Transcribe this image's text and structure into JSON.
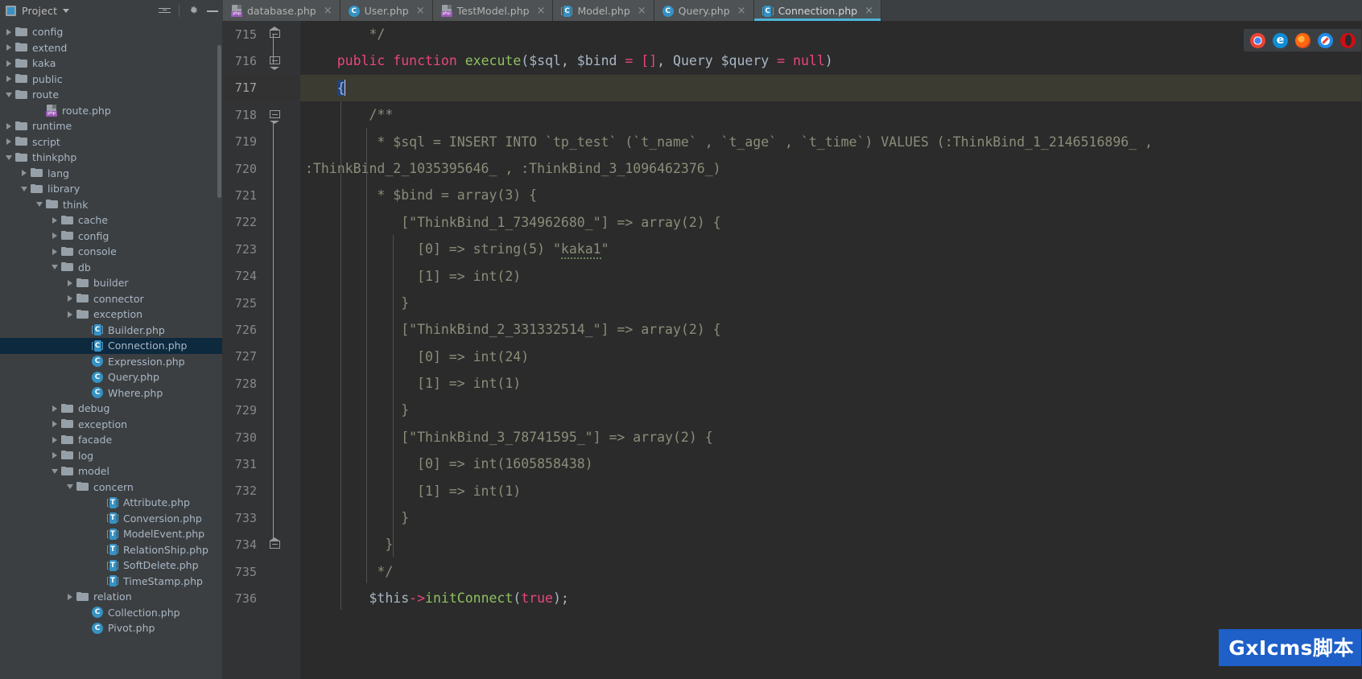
{
  "project_panel": {
    "title": "Project",
    "icons": [
      "collapse-all-icon",
      "settings-gear-icon",
      "hide-panel-icon"
    ],
    "tree": [
      {
        "label": "config",
        "type": "folder",
        "depth": 1,
        "state": "collapsed"
      },
      {
        "label": "extend",
        "type": "folder",
        "depth": 1,
        "state": "collapsed"
      },
      {
        "label": "kaka",
        "type": "folder",
        "depth": 1,
        "state": "collapsed"
      },
      {
        "label": "public",
        "type": "folder",
        "depth": 1,
        "state": "collapsed"
      },
      {
        "label": "route",
        "type": "folder",
        "depth": 1,
        "state": "expanded"
      },
      {
        "label": "route.php",
        "type": "php",
        "depth": 3,
        "state": "leaf"
      },
      {
        "label": "runtime",
        "type": "folder",
        "depth": 1,
        "state": "collapsed"
      },
      {
        "label": "script",
        "type": "folder",
        "depth": 1,
        "state": "collapsed"
      },
      {
        "label": "thinkphp",
        "type": "folder",
        "depth": 1,
        "state": "expanded"
      },
      {
        "label": "lang",
        "type": "folder",
        "depth": 2,
        "state": "collapsed"
      },
      {
        "label": "library",
        "type": "folder",
        "depth": 2,
        "state": "expanded"
      },
      {
        "label": "think",
        "type": "folder",
        "depth": 3,
        "state": "expanded"
      },
      {
        "label": "cache",
        "type": "folder",
        "depth": 4,
        "state": "collapsed"
      },
      {
        "label": "config",
        "type": "folder",
        "depth": 4,
        "state": "collapsed"
      },
      {
        "label": "console",
        "type": "folder",
        "depth": 4,
        "state": "collapsed"
      },
      {
        "label": "db",
        "type": "folder",
        "depth": 4,
        "state": "expanded"
      },
      {
        "label": "builder",
        "type": "folder",
        "depth": 5,
        "state": "collapsed"
      },
      {
        "label": "connector",
        "type": "folder",
        "depth": 5,
        "state": "collapsed"
      },
      {
        "label": "exception",
        "type": "folder",
        "depth": 5,
        "state": "collapsed"
      },
      {
        "label": "Builder.php",
        "type": "class-interface",
        "depth": 6,
        "state": "leaf"
      },
      {
        "label": "Connection.php",
        "type": "class-interface",
        "depth": 6,
        "state": "leaf",
        "selected": true
      },
      {
        "label": "Expression.php",
        "type": "class",
        "depth": 6,
        "state": "leaf"
      },
      {
        "label": "Query.php",
        "type": "class",
        "depth": 6,
        "state": "leaf"
      },
      {
        "label": "Where.php",
        "type": "class",
        "depth": 6,
        "state": "leaf"
      },
      {
        "label": "debug",
        "type": "folder",
        "depth": 4,
        "state": "collapsed"
      },
      {
        "label": "exception",
        "type": "folder",
        "depth": 4,
        "state": "collapsed"
      },
      {
        "label": "facade",
        "type": "folder",
        "depth": 4,
        "state": "collapsed"
      },
      {
        "label": "log",
        "type": "folder",
        "depth": 4,
        "state": "collapsed"
      },
      {
        "label": "model",
        "type": "folder",
        "depth": 4,
        "state": "expanded"
      },
      {
        "label": "concern",
        "type": "folder",
        "depth": 5,
        "state": "expanded"
      },
      {
        "label": "Attribute.php",
        "type": "trait",
        "depth": 7,
        "state": "leaf"
      },
      {
        "label": "Conversion.php",
        "type": "trait",
        "depth": 7,
        "state": "leaf"
      },
      {
        "label": "ModelEvent.php",
        "type": "trait",
        "depth": 7,
        "state": "leaf"
      },
      {
        "label": "RelationShip.php",
        "type": "trait",
        "depth": 7,
        "state": "leaf"
      },
      {
        "label": "SoftDelete.php",
        "type": "trait",
        "depth": 7,
        "state": "leaf"
      },
      {
        "label": "TimeStamp.php",
        "type": "trait",
        "depth": 7,
        "state": "leaf"
      },
      {
        "label": "relation",
        "type": "folder",
        "depth": 5,
        "state": "collapsed"
      },
      {
        "label": "Collection.php",
        "type": "class",
        "depth": 6,
        "state": "leaf"
      },
      {
        "label": "Pivot.php",
        "type": "class",
        "depth": 6,
        "state": "leaf"
      }
    ]
  },
  "tabs": [
    {
      "label": "database.php",
      "icon": "php-file-icon",
      "active": false,
      "close": "×"
    },
    {
      "label": "User.php",
      "icon": "class-file-icon",
      "active": false,
      "close": "×"
    },
    {
      "label": "TestModel.php",
      "icon": "php-file-icon",
      "active": false,
      "close": "×"
    },
    {
      "label": "Model.php",
      "icon": "class-interface-file-icon",
      "active": false,
      "close": "×"
    },
    {
      "label": "Query.php",
      "icon": "class-file-icon",
      "active": false,
      "close": "×"
    },
    {
      "label": "Connection.php",
      "icon": "class-interface-file-icon",
      "active": true,
      "close": "×"
    }
  ],
  "editor": {
    "line_numbers": [
      "715",
      "716",
      "717",
      "718",
      "719",
      "720",
      "721",
      "722",
      "723",
      "724",
      "725",
      "726",
      "727",
      "728",
      "729",
      "730",
      "731",
      "732",
      "733",
      "734",
      "735",
      "736"
    ],
    "current_line": "717",
    "lines": [
      {
        "num": "715",
        "text": "        */"
      },
      {
        "num": "716",
        "text": "    public function execute($sql, $bind = [], Query $query = null)"
      },
      {
        "num": "717",
        "text": "    {"
      },
      {
        "num": "718",
        "text": "        /**"
      },
      {
        "num": "719",
        "text": "         * $sql = INSERT INTO `tp_test` (`t_name` , `t_age` , `t_time`) VALUES (:ThinkBind_1_2146516896_ , :ThinkBind_2_1035395646_ , :ThinkBind_3_1096462376_)"
      },
      {
        "num": "720",
        "text": "         * $bind = array(3) {"
      },
      {
        "num": "721",
        "text": "            [\"ThinkBind_1_734962680_\"] => array(2) {"
      },
      {
        "num": "722",
        "text": "              [0] => string(5) \"kaka1\""
      },
      {
        "num": "723",
        "text": "              [1] => int(2)"
      },
      {
        "num": "724",
        "text": "            }"
      },
      {
        "num": "725",
        "text": "            [\"ThinkBind_2_331332514_\"] => array(2) {"
      },
      {
        "num": "726",
        "text": "              [0] => int(24)"
      },
      {
        "num": "727",
        "text": "              [1] => int(1)"
      },
      {
        "num": "728",
        "text": "            }"
      },
      {
        "num": "729",
        "text": "            [\"ThinkBind_3_78741595_\"] => array(2) {"
      },
      {
        "num": "730",
        "text": "              [0] => int(1605858438)"
      },
      {
        "num": "731",
        "text": "              [1] => int(1)"
      },
      {
        "num": "732",
        "text": "            }"
      },
      {
        "num": "733",
        "text": "          }"
      },
      {
        "num": "734",
        "text": "         */"
      },
      {
        "num": "735",
        "text": "        $this->initConnect(true);"
      },
      {
        "num": "736",
        "text": ""
      }
    ],
    "line_716_tokens": {
      "kw_public": "public",
      "kw_function": "function",
      "fn_name": "execute",
      "params": "($sql, $bind = [], Query $query = null)",
      "eq": "=",
      "brackets": "[]",
      "null_kw": "null"
    },
    "line_735_tokens": {
      "this": "$this",
      "arrow": "->",
      "method": "initConnect",
      "args": "(true)",
      "semi": ";",
      "true_kw": "true"
    },
    "colors": {
      "background": "#2b2b2b",
      "gutter": "#313335",
      "comment": "#8c8c7a",
      "keyword": "#e8467c",
      "function_name": "#8ec160",
      "plain_text": "#a9b7c6",
      "current_line": "#323232",
      "selection": "#214283",
      "caret": "#d4d4d4"
    },
    "typo_word": "kaka1"
  },
  "browser_strip": {
    "icons": [
      "chrome-browser-icon",
      "edge-browser-icon",
      "firefox-browser-icon",
      "safari-browser-icon",
      "opera-browser-icon"
    ]
  },
  "watermark": {
    "text": "GxIcms脚本",
    "background": "#1e5fc8",
    "color": "#ffffff"
  }
}
